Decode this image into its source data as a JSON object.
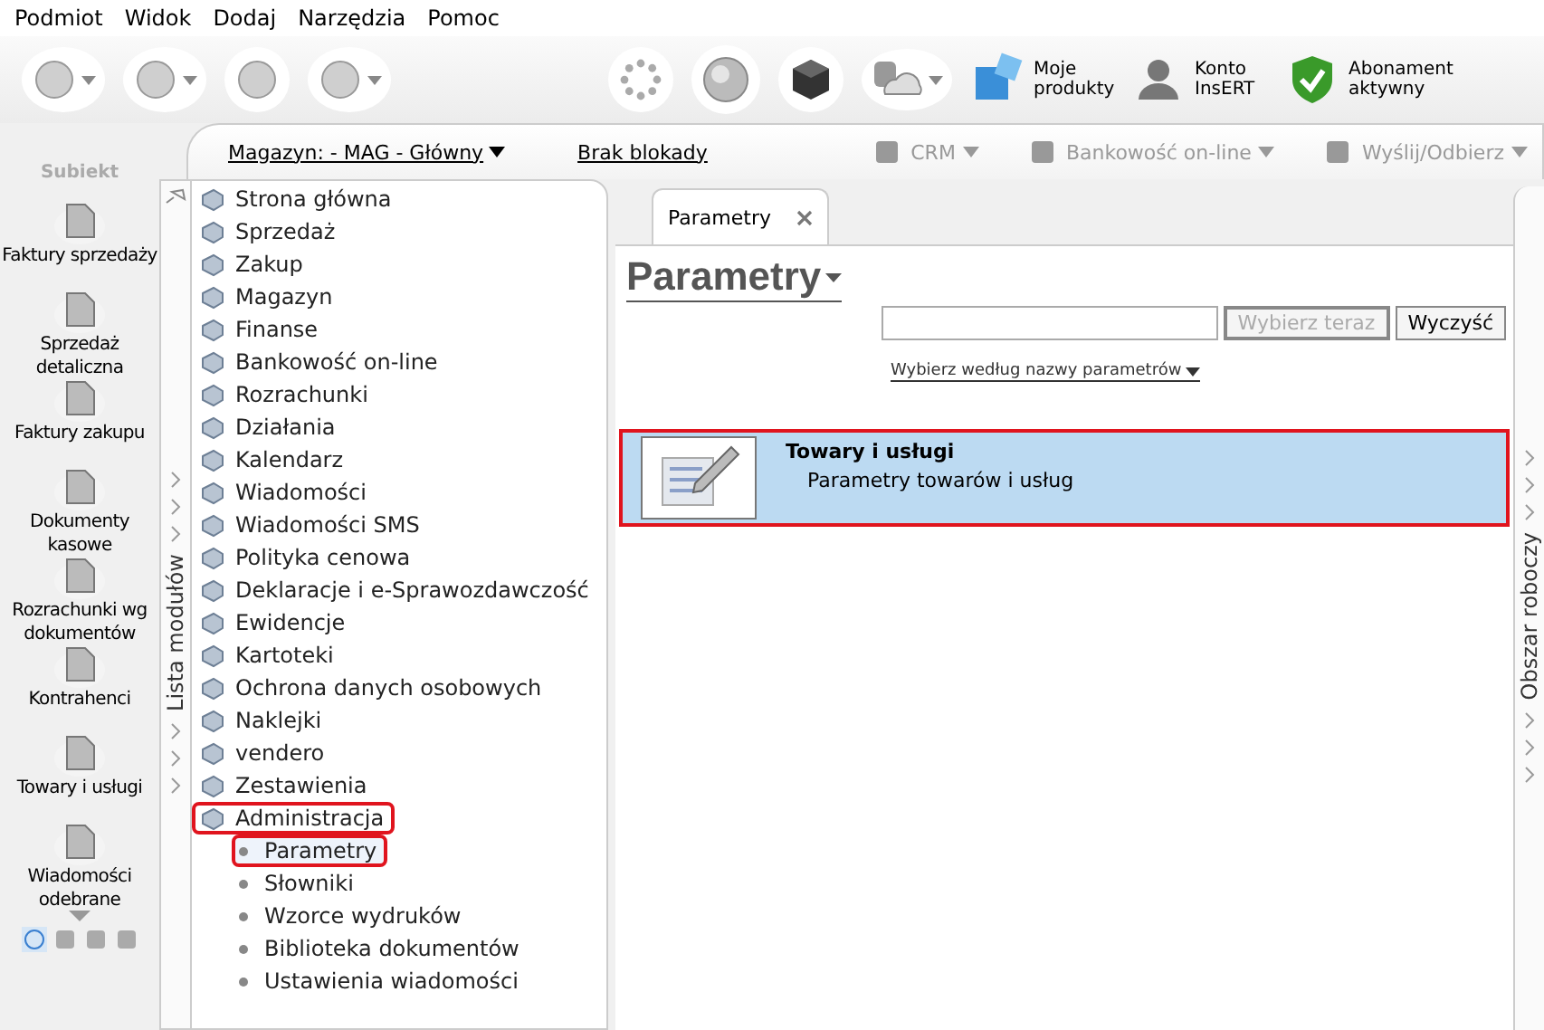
{
  "menu": [
    "Podmiot",
    "Widok",
    "Dodaj",
    "Narzędzia",
    "Pomoc"
  ],
  "toolbar_labels": [
    {
      "kind": "products",
      "label": "Moje produkty"
    },
    {
      "kind": "account",
      "label": "Konto InsERT"
    },
    {
      "kind": "subscription",
      "label": "Abonament aktywny"
    }
  ],
  "app_logo": "Subiekt",
  "subbar": {
    "warehouse": "Magazyn: - MAG - Główny",
    "lock": "Brak blokady",
    "actions": [
      "CRM",
      "Bankowość on-line",
      "Wyślij/Odbierz"
    ]
  },
  "shortcuts": [
    "Faktury sprzedaży",
    "Sprzedaż detaliczna",
    "Faktury zakupu",
    "Dokumenty kasowe",
    "Rozrachunki wg dokumentów",
    "Kontrahenci",
    "Towary i usługi",
    "Wiadomości odebrane"
  ],
  "module_panel": {
    "title": "Lista modułów",
    "modules": [
      {
        "label": "Strona główna",
        "highlighted": false
      },
      {
        "label": "Sprzedaż",
        "highlighted": false
      },
      {
        "label": "Zakup",
        "highlighted": false
      },
      {
        "label": "Magazyn",
        "highlighted": false
      },
      {
        "label": "Finanse",
        "highlighted": false
      },
      {
        "label": "Bankowość on-line",
        "highlighted": false
      },
      {
        "label": "Rozrachunki",
        "highlighted": false
      },
      {
        "label": "Działania",
        "highlighted": false
      },
      {
        "label": "Kalendarz",
        "highlighted": false
      },
      {
        "label": "Wiadomości",
        "highlighted": false
      },
      {
        "label": "Wiadomości SMS",
        "highlighted": false
      },
      {
        "label": "Polityka cenowa",
        "highlighted": false
      },
      {
        "label": "Deklaracje i e-Sprawozdawczość",
        "highlighted": false
      },
      {
        "label": "Ewidencje",
        "highlighted": false
      },
      {
        "label": "Kartoteki",
        "highlighted": false
      },
      {
        "label": "Ochrona danych osobowych",
        "highlighted": false
      },
      {
        "label": "Naklejki",
        "highlighted": false
      },
      {
        "label": "vendero",
        "highlighted": false
      },
      {
        "label": "Zestawienia",
        "highlighted": false
      },
      {
        "label": "Administracja",
        "highlighted": true,
        "children": [
          {
            "label": "Parametry",
            "highlighted": true,
            "selected": true
          },
          {
            "label": "Słowniki",
            "highlighted": false,
            "selected": false
          },
          {
            "label": "Wzorce wydruków",
            "highlighted": false,
            "selected": false
          },
          {
            "label": "Biblioteka dokumentów",
            "highlighted": false,
            "selected": false
          },
          {
            "label": "Ustawienia wiadomości",
            "highlighted": false,
            "selected": false
          }
        ]
      }
    ]
  },
  "tabs": [
    {
      "label": "Parametry",
      "selected": true
    }
  ],
  "heading": "Parametry",
  "search": {
    "buttons": [
      {
        "label": "Wybierz teraz",
        "disabled": true
      },
      {
        "label": "Wyczyść",
        "disabled": false
      }
    ],
    "filter": "Wybierz według nazwy parametrów"
  },
  "results": [
    {
      "title": "Towary i usługi",
      "subtitle": "Parametry towarów i usług",
      "selected": true,
      "highlighted": true
    }
  ],
  "right_panel": {
    "title": "Obszar roboczy"
  }
}
